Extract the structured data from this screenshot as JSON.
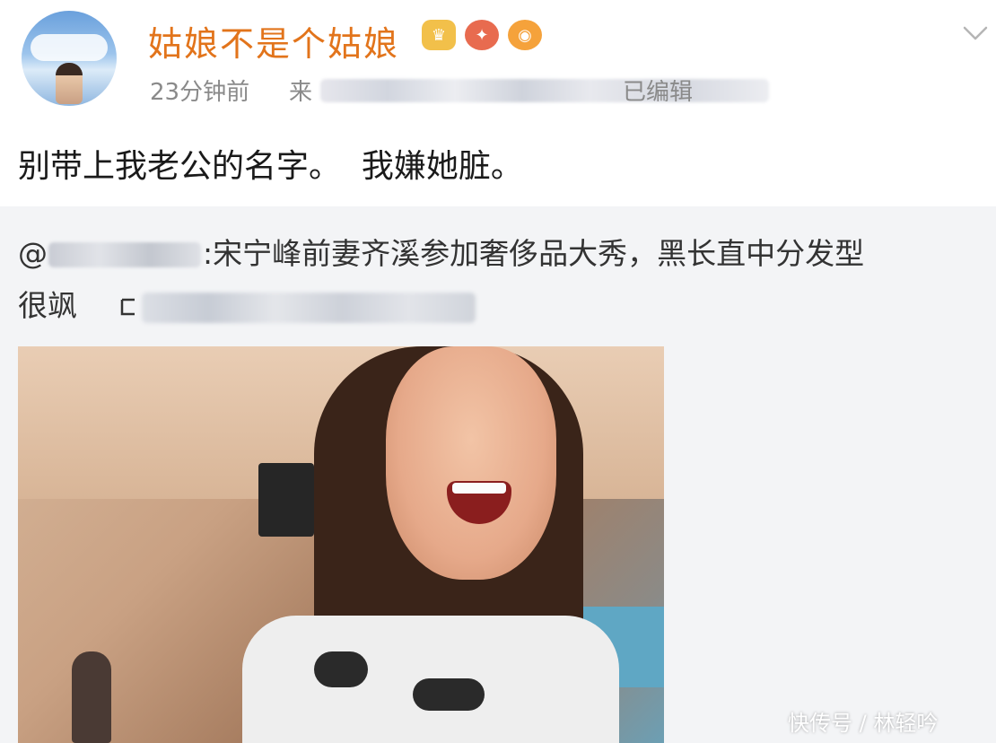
{
  "post": {
    "username": "姑娘不是个姑娘",
    "badges": [
      "crown-badge",
      "fire-badge",
      "fish-badge"
    ],
    "time": "23分钟前",
    "source_label": "来",
    "edited": "已编辑",
    "text": "别带上我老公的名字。  我嫌她脏。"
  },
  "repost": {
    "at": "@",
    "content_line1": ":宋宁峰前妻齐溪参加奢侈品大秀，黑长直中分发型",
    "content_line2": "很飒"
  },
  "watermark": "快传号 / 林轻吟",
  "colors": {
    "username": "#e2741b",
    "meta": "#8a8a8a",
    "repost_bg": "#f3f4f6"
  }
}
